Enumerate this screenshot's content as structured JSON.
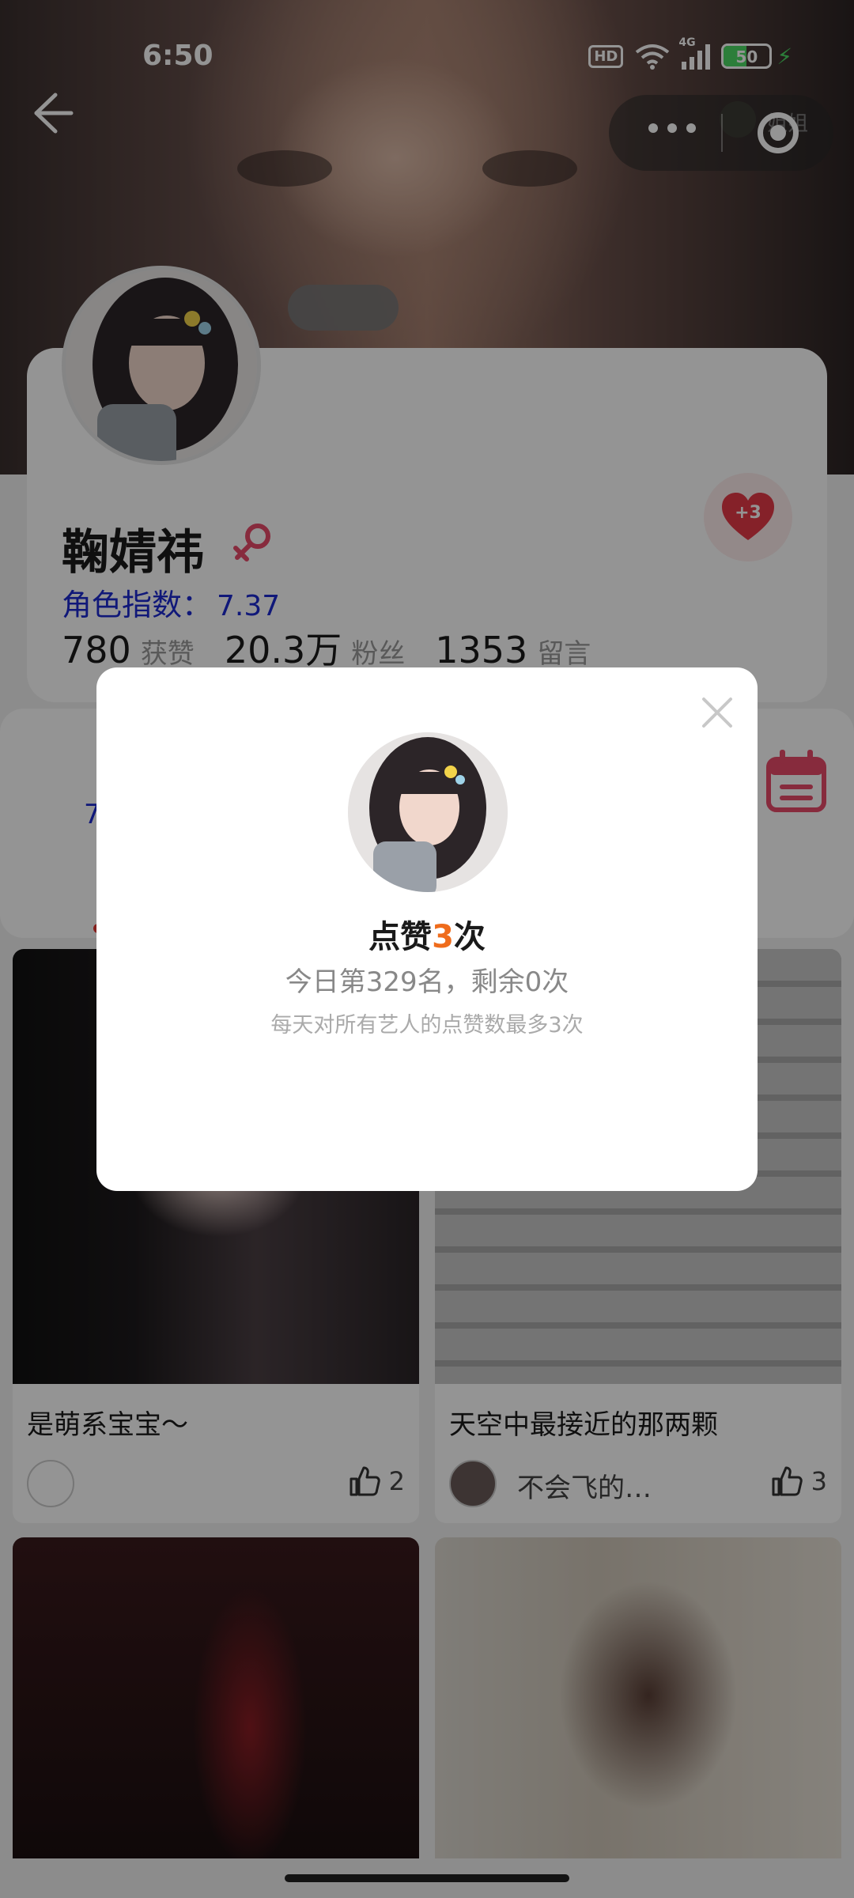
{
  "status": {
    "time": "6:50",
    "hd": "HD",
    "network": "4G",
    "battery": "50",
    "battery_level": 0.5
  },
  "header": {
    "mini_label": "姐姐"
  },
  "profile": {
    "name": "鞠婧祎",
    "index_label": "角色指数：",
    "index_value": "7.37",
    "stats": [
      {
        "value": "780",
        "label": "获赞"
      },
      {
        "value": "20.3万",
        "label": "粉丝"
      },
      {
        "value": "1353",
        "label": "留言"
      }
    ],
    "like_fab_plus": "+3"
  },
  "second_card": {
    "peek_char": "7"
  },
  "grid": {
    "tiles": [
      {
        "title": "是萌系宝宝～",
        "author": "",
        "likes": "2"
      },
      {
        "title": "天空中最接近的那两颗",
        "author": "不会飞的…",
        "likes": "3"
      }
    ]
  },
  "modal": {
    "title_prefix": "点赞",
    "title_count": "3",
    "title_suffix": "次",
    "rank_text": "今日第329名，剩余0次",
    "note": "每天对所有艺人的点赞数最多3次"
  },
  "colors": {
    "accent_blue": "#1d2ad0",
    "like_red": "#e53948",
    "count_orange": "#ef6c1c",
    "calendar_pink": "#e84a6a"
  }
}
